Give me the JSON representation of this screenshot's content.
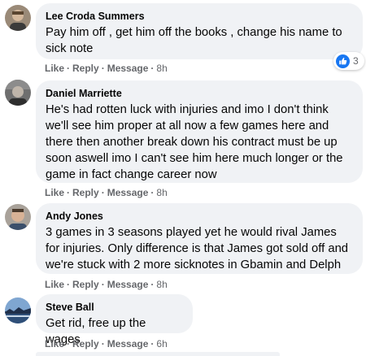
{
  "comments": [
    {
      "author": "Lee Croda Summers",
      "text": "Pay him off , get him off the books , change his name to sick note",
      "like_label": "Like",
      "reply_label": "Reply",
      "message_label": "Message",
      "time": "8h",
      "reaction": {
        "icon": "like-icon",
        "count": "3",
        "color": "#1877f2"
      }
    },
    {
      "author": "Daniel Marriette",
      "text": "He's had rotten luck with injuries and imo I don't think we'll see him proper at all now a few games here and there then another break down his contract must be up soon aswell imo I can't see him here much longer or the game in fact change career now",
      "like_label": "Like",
      "reply_label": "Reply",
      "message_label": "Message",
      "time": "8h"
    },
    {
      "author": "Andy Jones",
      "text": "3 games in 3 seasons played yet he would rival James for injuries. Only difference is that James got sold off and we're stuck with 2 more sicknotes in Gbamin and Delph",
      "like_label": "Like",
      "reply_label": "Reply",
      "message_label": "Message",
      "time": "8h"
    },
    {
      "author": "Steve Ball",
      "text": "Get rid, free up the wages",
      "like_label": "Like",
      "reply_label": "Reply",
      "message_label": "Message",
      "time": "6h"
    }
  ],
  "colors": {
    "bubble_bg": "#f0f2f5",
    "meta_text": "#65676b",
    "accent": "#1877f2"
  }
}
